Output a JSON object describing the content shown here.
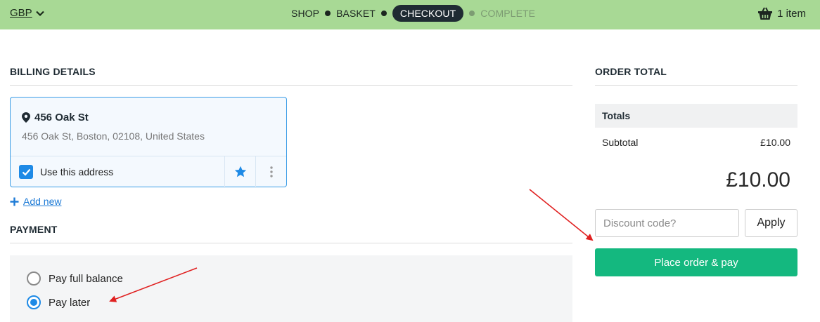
{
  "header": {
    "currency": "GBP",
    "steps": [
      "SHOP",
      "BASKET",
      "CHECKOUT",
      "COMPLETE"
    ],
    "active_step": "CHECKOUT",
    "basket_label": "1 item"
  },
  "billing": {
    "title": "BILLING DETAILS",
    "address_name": "456 Oak St",
    "address_full": "456 Oak St, Boston, 02108, United States",
    "use_address_label": "Use this address",
    "add_new_label": "Add new"
  },
  "payment": {
    "title": "PAYMENT",
    "options": [
      {
        "label": "Pay full balance",
        "checked": false
      },
      {
        "label": "Pay later",
        "checked": true
      }
    ]
  },
  "order": {
    "title": "ORDER TOTAL",
    "totals_label": "Totals",
    "subtotal_label": "Subtotal",
    "subtotal_value": "£10.00",
    "grand_total": "£10.00",
    "discount_placeholder": "Discount code?",
    "apply_label": "Apply",
    "place_order_label": "Place order & pay"
  },
  "colors": {
    "topbar": "#a8d995",
    "accent": "#1e8ae6",
    "place_order": "#14b87f",
    "annotation_arrow": "#e02020"
  }
}
